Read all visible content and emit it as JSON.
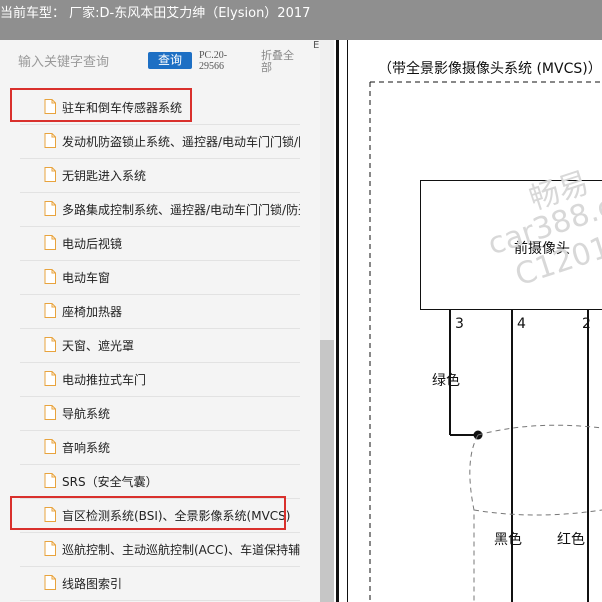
{
  "window": {
    "title": "当前车型：  厂家:D-东风本田艾力绅（Elysion）2017"
  },
  "sidebar": {
    "search_placeholder": "输入关键字查询",
    "query_label": "查询",
    "page_code": "PC.20-29566",
    "collapse_label": "折叠全部",
    "corner_glyph": "E",
    "items": [
      {
        "label": "驻车和倒车传感器系统",
        "highlighted": true
      },
      {
        "label": "发动机防盗锁止系统、遥控器/电动车门门锁/防",
        "highlighted": false
      },
      {
        "label": "无钥匙进入系统",
        "highlighted": false
      },
      {
        "label": "多路集成控制系统、遥控器/电动车门门锁/防盗",
        "highlighted": false
      },
      {
        "label": "电动后视镜",
        "highlighted": false
      },
      {
        "label": "电动车窗",
        "highlighted": false
      },
      {
        "label": "座椅加热器",
        "highlighted": false
      },
      {
        "label": "天窗、遮光罩",
        "highlighted": false
      },
      {
        "label": "电动推拉式车门",
        "highlighted": false
      },
      {
        "label": "导航系统",
        "highlighted": false
      },
      {
        "label": "音响系统",
        "highlighted": false
      },
      {
        "label": "SRS（安全气囊）",
        "highlighted": false
      },
      {
        "label": "盲区检测系统(BSI)、全景影像系统(MVCS)",
        "highlighted": true
      },
      {
        "label": "巡航控制、主动巡航控制(ACC)、车道保持辅助",
        "highlighted": false
      },
      {
        "label": "线路图索引",
        "highlighted": false
      }
    ]
  },
  "diagram": {
    "title": "（带全景影像摄像头系统 (MVCS)）",
    "component": "前摄像头",
    "pins": [
      "3",
      "4",
      "2"
    ],
    "wire_colors": {
      "green": "绿色",
      "black": "黑色",
      "red": "红色"
    },
    "watermark": [
      "畅易",
      "car388.c",
      "C1201"
    ]
  },
  "colors": {
    "accent": "#1d6fc4",
    "highlight": "#d9302c",
    "titlebar": "#8f8f8f"
  }
}
